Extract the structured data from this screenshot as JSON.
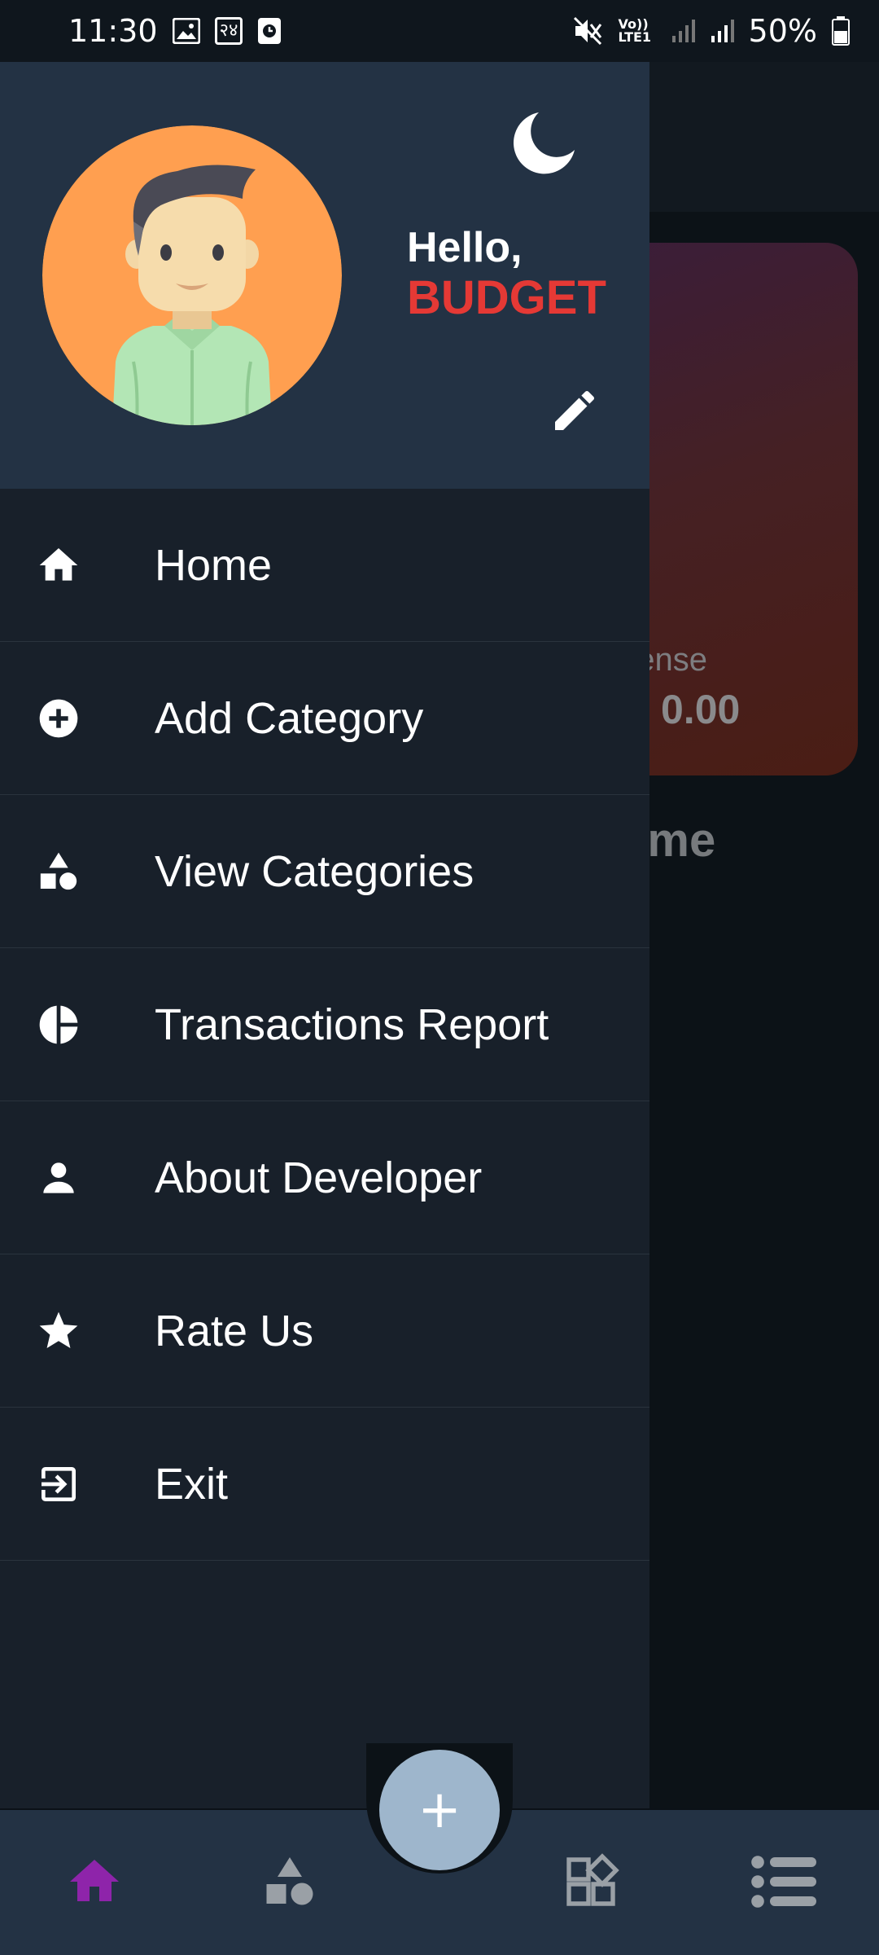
{
  "status_bar": {
    "time": "11:30",
    "carrier_badge": "२४",
    "network_label": "Vo)) LTE1",
    "battery": "50%"
  },
  "background_screen": {
    "card_label": "pense",
    "card_value": "0.00",
    "section_heading": "ome"
  },
  "drawer": {
    "greeting": "Hello,",
    "username": "BUDGET",
    "menu": [
      {
        "label": "Home",
        "icon": "home-icon"
      },
      {
        "label": "Add Category",
        "icon": "add-circle-icon"
      },
      {
        "label": "View Categories",
        "icon": "shapes-icon"
      },
      {
        "label": "Transactions Report",
        "icon": "pie-chart-icon"
      },
      {
        "label": "About Developer",
        "icon": "person-icon"
      },
      {
        "label": "Rate Us",
        "icon": "star-icon"
      },
      {
        "label": "Exit",
        "icon": "exit-icon"
      }
    ]
  },
  "bottom_nav": {
    "items": [
      "home-icon",
      "shapes-icon",
      "widgets-icon",
      "list-icon"
    ],
    "active": "home-icon",
    "fab_label": "+"
  },
  "colors": {
    "drawer_bg": "#18202a",
    "header_bg": "#233244",
    "username": "#e53935",
    "avatar_bg": "#ff9f50",
    "nav_active": "#8e24aa",
    "nav_inactive": "#9aa0a6",
    "fab_bg": "#9eb6cc"
  }
}
